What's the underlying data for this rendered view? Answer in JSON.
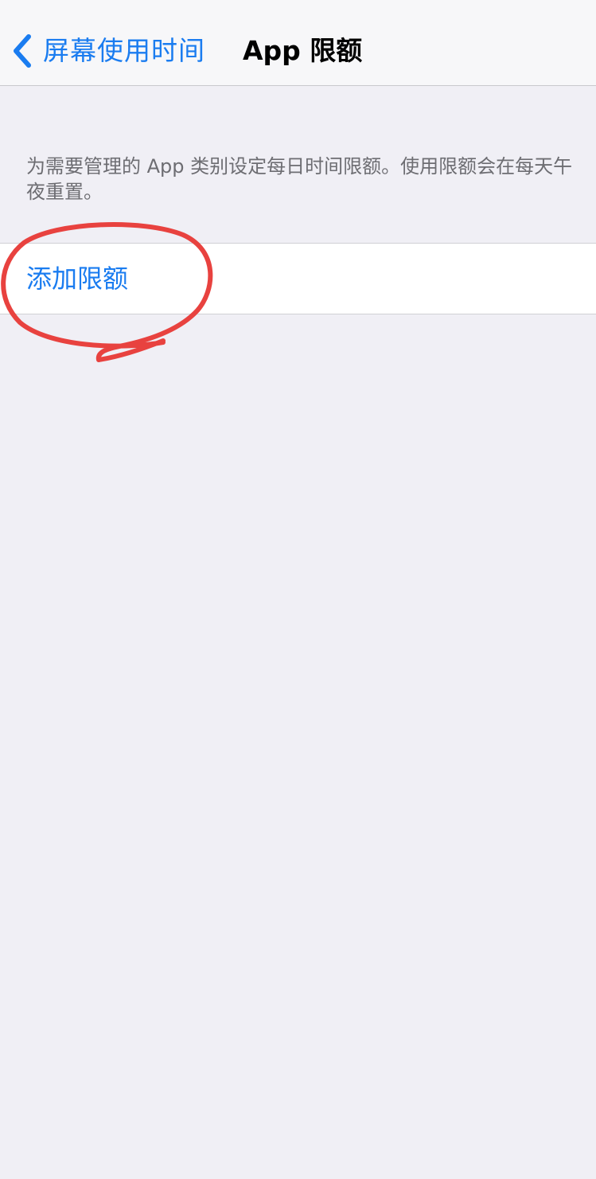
{
  "nav": {
    "back_label": "屏幕使用时间",
    "title": "App 限额"
  },
  "description": "为需要管理的 App 类别设定每日时间限额。使用限额会在每天午夜重置。",
  "actions": {
    "add_limit_label": "添加限额"
  },
  "colors": {
    "accent": "#1a7cf0",
    "background": "#f0eff5",
    "annotation": "#e8423f"
  }
}
